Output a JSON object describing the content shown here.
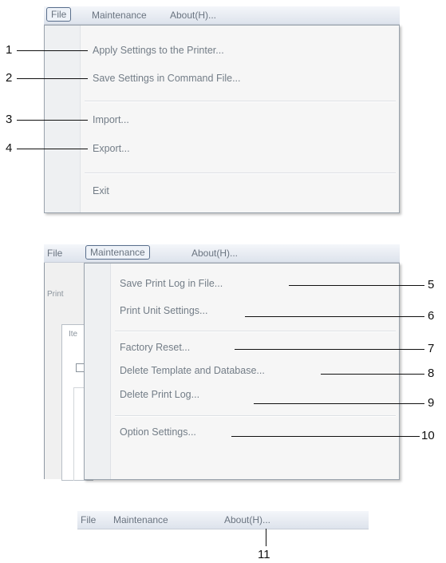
{
  "menubar": {
    "file": "File",
    "maintenance": "Maintenance",
    "about": "About(H)..."
  },
  "file_menu": {
    "apply": "Apply Settings to the Printer...",
    "save_cmd": "Save Settings in Command File...",
    "import": "Import...",
    "export": "Export...",
    "exit": "Exit"
  },
  "maintenance_menu": {
    "save_log": "Save Print Log in File...",
    "print_unit": "Print Unit Settings...",
    "factory_reset": "Factory Reset...",
    "delete_template": "Delete Template and Database...",
    "delete_log": "Delete Print Log...",
    "option": "Option Settings..."
  },
  "background": {
    "label1": "Print",
    "label2": "Ite"
  },
  "callouts": [
    "1",
    "2",
    "3",
    "4",
    "5",
    "6",
    "7",
    "8",
    "9",
    "10",
    "11"
  ]
}
